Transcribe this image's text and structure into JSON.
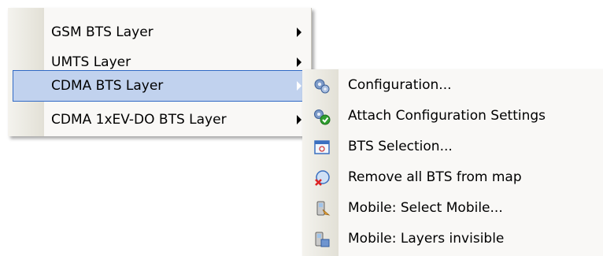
{
  "main_menu": {
    "items": [
      {
        "label": "GSM BTS Layer",
        "has_submenu": true,
        "selected": false
      },
      {
        "label": "UMTS Layer",
        "has_submenu": true,
        "selected": false
      },
      {
        "label": "CDMA BTS Layer",
        "has_submenu": true,
        "selected": true
      },
      {
        "label": "CDMA 1xEV-DO BTS Layer",
        "has_submenu": true,
        "selected": false
      }
    ]
  },
  "submenu": {
    "items": [
      {
        "label": "Configuration...",
        "icon": "gears-icon"
      },
      {
        "label": "Attach Configuration Settings",
        "icon": "gears-check-icon"
      },
      {
        "label": "BTS Selection...",
        "icon": "window-select-icon"
      },
      {
        "label": "Remove all BTS from map",
        "icon": "remove-map-icon"
      },
      {
        "label": "Mobile: Select Mobile...",
        "icon": "mobile-select-icon"
      },
      {
        "label": "Mobile: Layers invisible",
        "icon": "mobile-layers-icon"
      }
    ]
  },
  "colors": {
    "selection_fill": "#c1d2ee",
    "selection_border": "#316ac5",
    "menu_background": "#f9f8f6"
  }
}
